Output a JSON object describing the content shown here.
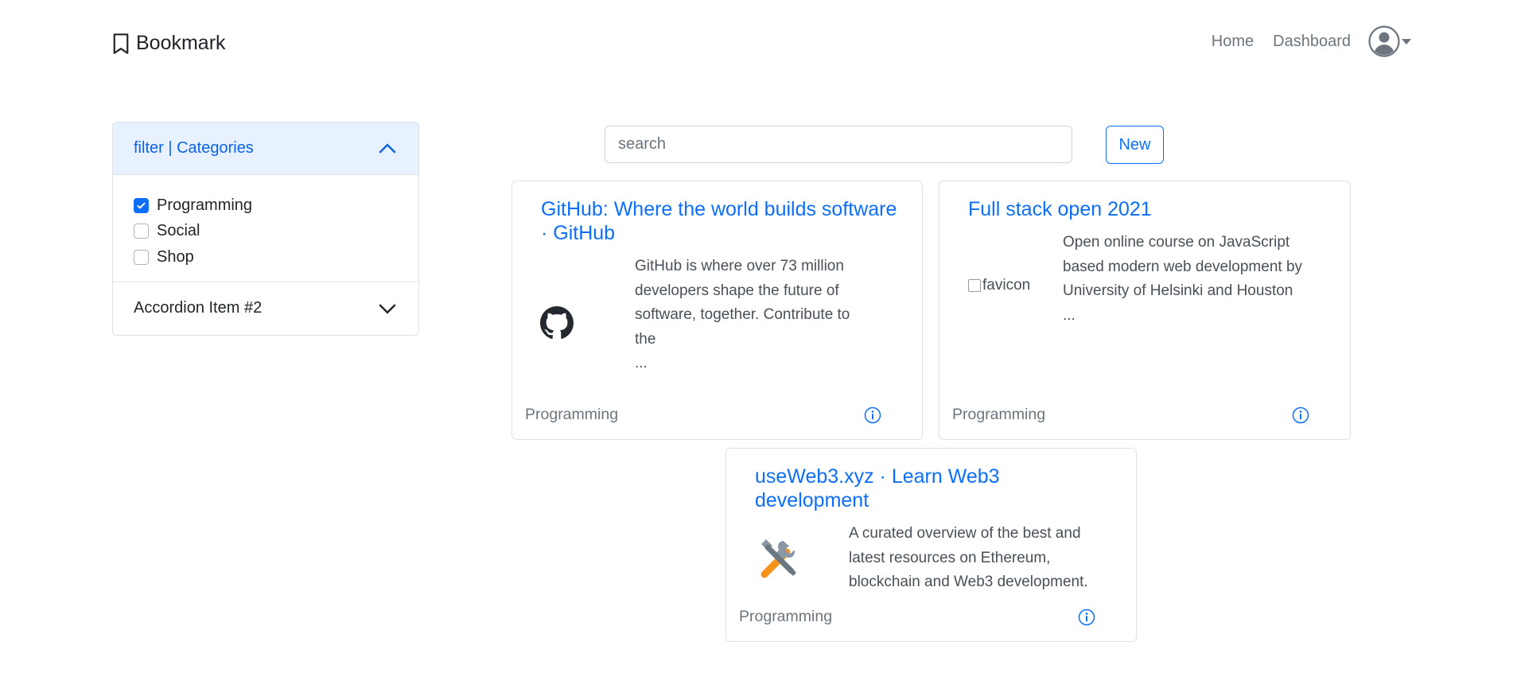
{
  "navbar": {
    "brand": "Bookmark",
    "links": [
      "Home",
      "Dashboard"
    ]
  },
  "accordion": {
    "item1_title": "filter | Categories",
    "categories": [
      {
        "label": "Programming",
        "checked": true
      },
      {
        "label": "Social",
        "checked": false
      },
      {
        "label": "Shop",
        "checked": false
      }
    ],
    "item2_title": "Accordion Item #2"
  },
  "search": {
    "placeholder": "search"
  },
  "new_button": "New",
  "cards": [
    {
      "title": "GitHub: Where the world builds software · GitHub",
      "description_lines": [
        "GitHub is where over 73 million",
        "developers shape the future of",
        "software, together. Contribute to",
        "the",
        "..."
      ],
      "category": "Programming",
      "icon": "github-icon"
    },
    {
      "title": "Full stack open 2021",
      "image_alt": "favicon",
      "description_lines": [
        "Open online course on JavaScript",
        "based modern web development by",
        "University of Helsinki and Houston",
        "..."
      ],
      "category": "Programming",
      "icon": "broken-image-icon"
    },
    {
      "title": "useWeb3.xyz · Learn Web3 development",
      "description_lines": [
        "A curated overview of the best and",
        "latest resources on Ethereum,",
        "blockchain and Web3 development."
      ],
      "category": "Programming",
      "icon": "tools-icon"
    }
  ],
  "colors": {
    "accent": "#0d6efd",
    "muted": "#6c757d",
    "border": "#dee2e6",
    "accordion_active": "#e7f1ff"
  }
}
